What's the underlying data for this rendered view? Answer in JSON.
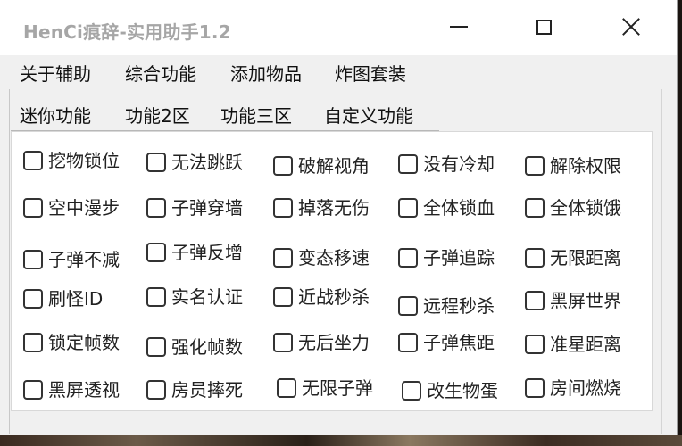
{
  "window": {
    "title": "HenCi痕辞-实用助手1.2"
  },
  "tabs_top": [
    "关于辅助",
    "综合功能",
    "添加物品",
    "炸图套装"
  ],
  "tabs_sub": [
    "迷你功能",
    "功能2区",
    "功能三区",
    "自定义功能"
  ],
  "checkboxes": [
    [
      "挖物锁位",
      "无法跳跃",
      "破解视角",
      "没有冷却",
      "解除权限"
    ],
    [
      "空中漫步",
      "子弹穿墙",
      "掉落无伤",
      "全体锁血",
      "全体锁饿"
    ],
    [
      "子弹不减",
      "子弹反增",
      "变态移速",
      "子弹追踪",
      "无限距离"
    ],
    [
      "刷怪ID",
      "实名认证",
      "近战秒杀",
      "远程秒杀",
      "黑屏世界"
    ],
    [
      "锁定帧数",
      "强化帧数",
      "无后坐力",
      "子弹焦距",
      "准星距离"
    ],
    [
      "黑屏透视",
      "房员摔死",
      "无限子弹",
      "改生物蛋",
      "房间燃烧"
    ]
  ]
}
